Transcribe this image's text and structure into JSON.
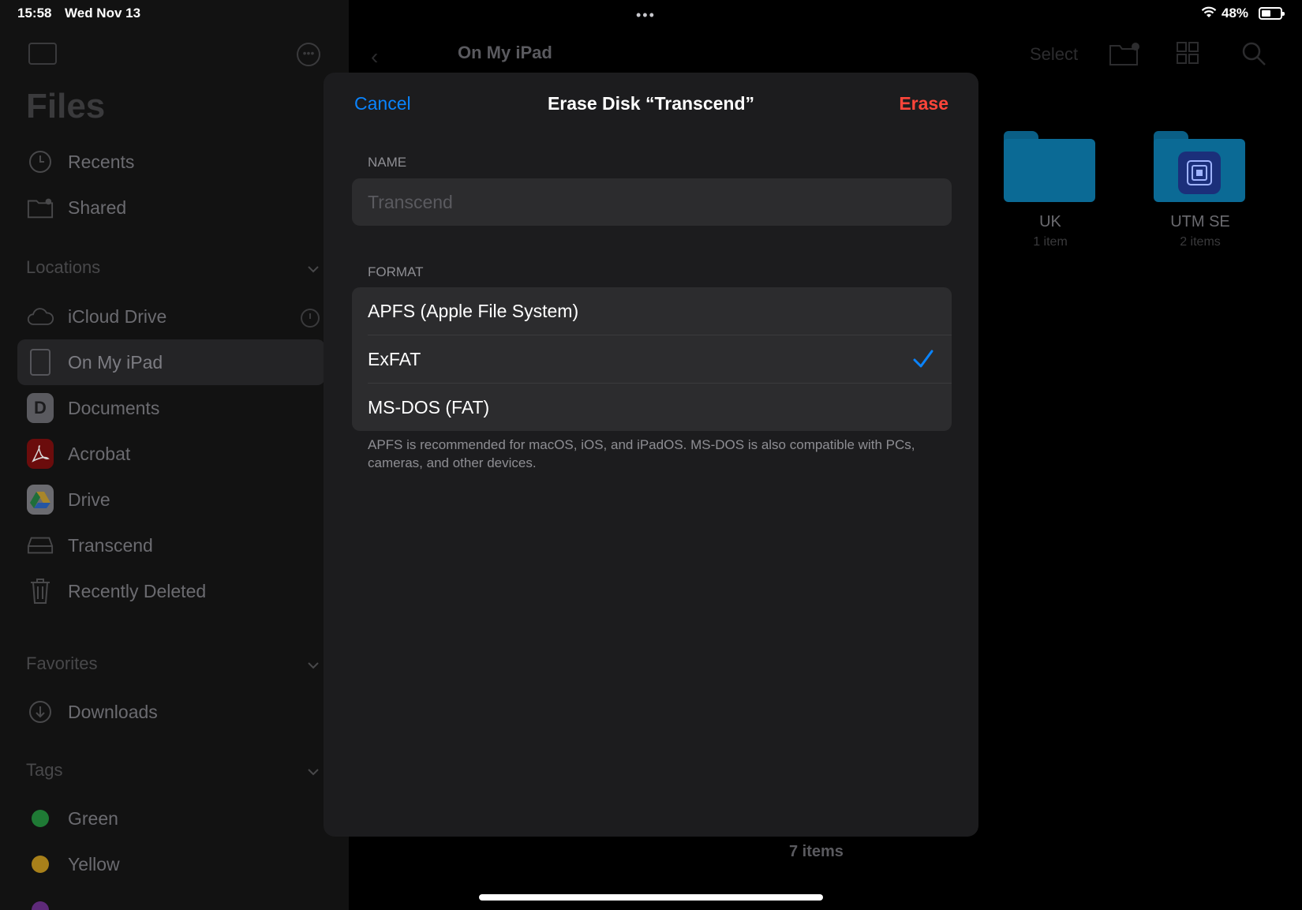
{
  "status_bar": {
    "time": "15:58",
    "date": "Wed Nov 13",
    "battery": "48%"
  },
  "sidebar": {
    "app_title": "Files",
    "top_items": [
      {
        "label": "Recents",
        "icon": "clock-icon"
      },
      {
        "label": "Shared",
        "icon": "shared-folder-icon"
      }
    ],
    "locations_header": "Locations",
    "locations": [
      {
        "label": "iCloud Drive",
        "icon": "cloud-icon"
      },
      {
        "label": "On My iPad",
        "icon": "ipad-icon",
        "selected": true
      },
      {
        "label": "Documents",
        "icon": "documents-app-icon"
      },
      {
        "label": "Acrobat",
        "icon": "acrobat-app-icon"
      },
      {
        "label": "Drive",
        "icon": "google-drive-icon"
      },
      {
        "label": "Transcend",
        "icon": "external-drive-icon"
      },
      {
        "label": "Recently Deleted",
        "icon": "trash-icon"
      }
    ],
    "favorites_header": "Favorites",
    "favorites": [
      {
        "label": "Downloads",
        "icon": "download-icon"
      }
    ],
    "tags_header": "Tags",
    "tags": [
      {
        "label": "Green",
        "color": "#1f8c3a"
      },
      {
        "label": "Yellow",
        "color": "#b88a12"
      }
    ]
  },
  "main": {
    "title": "On My iPad",
    "select_label": "Select",
    "folders": [
      {
        "name": "UK",
        "count": "1 item"
      },
      {
        "name": "UTM SE",
        "count": "2 items"
      }
    ],
    "items_count": "7 items"
  },
  "dialog": {
    "cancel_label": "Cancel",
    "title": "Erase Disk “Transcend”",
    "erase_label": "Erase",
    "name_section": "NAME",
    "name_placeholder": "Transcend",
    "format_section": "FORMAT",
    "formats": [
      {
        "label": "APFS (Apple File System)",
        "selected": false
      },
      {
        "label": "ExFAT",
        "selected": true
      },
      {
        "label": "MS-DOS (FAT)",
        "selected": false
      }
    ],
    "footnote": "APFS is recommended for macOS, iOS, and iPadOS. MS-DOS is also compatible with PCs, cameras, and other devices."
  },
  "colors": {
    "accent": "#0a84ff",
    "destructive": "#ff453a",
    "folder": "#0b6a95"
  }
}
